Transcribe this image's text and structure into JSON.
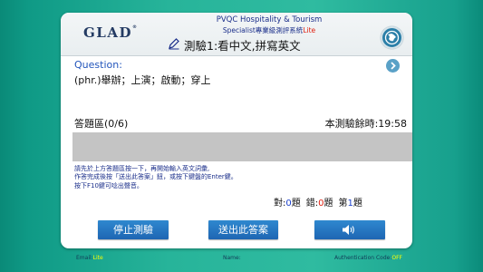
{
  "header": {
    "logo_text": "GLAD",
    "logo_mark": "®",
    "title_line1": "PVQC Hospitality & Tourism",
    "title_line2": "Specialist專業級測評系統",
    "title_line2_suffix": "Lite",
    "title_main": "測驗1:看中文,拼寫英文",
    "pencil_icon": "pencil-icon",
    "globe_icon": "globe-icon"
  },
  "question": {
    "label": "Question:",
    "text": "(phr.)舉辦；上演；啟動；穿上",
    "next_icon": "chevron-right-icon"
  },
  "answer": {
    "area_label": "答題區(0/6)",
    "time_label": "本測驗餘時:",
    "time_value": "19:58",
    "input_value": ""
  },
  "instructions": [
    "請先於上方答題區按一下，再開始輸入英文詞彙,",
    "作答完成後按「送出此答案」鈕，或按下鍵盤的Enter鍵。",
    "按下F10鍵可唸出聲音。"
  ],
  "score": {
    "correct_label": "對:",
    "correct_value": "0",
    "correct_unit": "題",
    "wrong_label": "錯:",
    "wrong_value": "0",
    "wrong_unit": "題",
    "question_prefix": "第",
    "question_value": "1",
    "question_unit": "題"
  },
  "buttons": {
    "stop": "停止測驗",
    "submit": "送出此答案",
    "sound_icon": "speaker-icon"
  },
  "footer": {
    "email_label": "Email:",
    "email_value": "Lite",
    "name_label": "Name:",
    "auth_label": "Authentication Code:",
    "auth_value": "OFF"
  },
  "colors": {
    "background": "#27b49a",
    "title_blue": "#1a2e8a",
    "accent_red": "#e02010",
    "button_blue": "#1e66b3",
    "footer_value": "#ffff00"
  }
}
